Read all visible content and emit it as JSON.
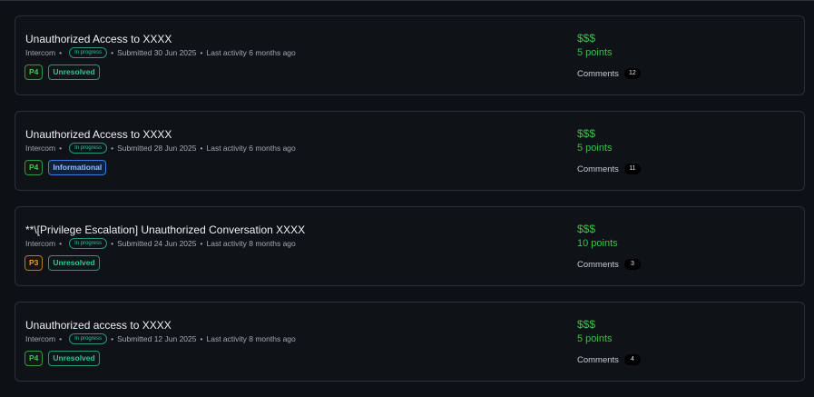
{
  "reports": [
    {
      "title": "Unauthorized Access to XXXX",
      "program": "Intercom",
      "status": "In progress",
      "submitted": "Submitted 30 Jun 2025",
      "last_activity": "Last activity 6 months ago",
      "priority": "P4",
      "state": "Unresolved",
      "reward": "$$$",
      "points": "5 points",
      "comments_label": "Comments",
      "comments_count": "12"
    },
    {
      "title": "Unauthorized Access to XXXX",
      "program": "Intercom",
      "status": "In progress",
      "submitted": "Submitted 28 Jun 2025",
      "last_activity": "Last activity 6 months ago",
      "priority": "P4",
      "state": "Informational",
      "reward": "$$$",
      "points": "5 points",
      "comments_label": "Comments",
      "comments_count": "11"
    },
    {
      "title": "**\\[Privilege Escalation] Unauthorized Conversation XXXX",
      "program": "Intercom",
      "status": "In progress",
      "submitted": "Submitted 24 Jun 2025",
      "last_activity": "Last activity 8 months ago",
      "priority": "P3",
      "state": "Unresolved",
      "reward": "$$$",
      "points": "10 points",
      "comments_label": "Comments",
      "comments_count": "3"
    },
    {
      "title": "Unauthorized access to XXXX",
      "program": "Intercom",
      "status": "In progress",
      "submitted": "Submitted 12 Jun 2025",
      "last_activity": "Last activity 8 months ago",
      "priority": "P4",
      "state": "Unresolved",
      "reward": "$$$",
      "points": "5 points",
      "comments_label": "Comments",
      "comments_count": "4"
    }
  ],
  "meta_separator": "•"
}
